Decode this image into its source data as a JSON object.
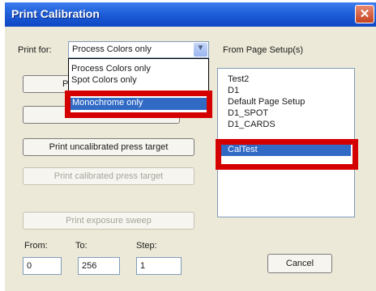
{
  "window": {
    "title": "Print Calibration"
  },
  "print_for": {
    "label": "Print for:",
    "selected": "Process Colors only",
    "options": [
      "Process Colors only",
      "Spot Colors only",
      "Monochrome only"
    ]
  },
  "page_setups": {
    "label": "From Page Setup(s)",
    "items": [
      "Test2",
      "D1",
      "Default Page Setup",
      "D1_SPOT",
      "D1_CARDS",
      "CalTest"
    ]
  },
  "buttons": {
    "hidden_1_partial": "P",
    "uncalibrated": "Print uncalibrated press target",
    "calibrated": "Print calibrated press target",
    "exposure": "Print exposure sweep",
    "cancel": "Cancel"
  },
  "range": {
    "from_label": "From:",
    "from_value": "0",
    "to_label": "To:",
    "to_value": "256",
    "step_label": "Step:",
    "step_value": "1"
  },
  "colors": {
    "title_bar": "#1f5fd8",
    "selection": "#316ac5",
    "highlight": "#d40000"
  }
}
